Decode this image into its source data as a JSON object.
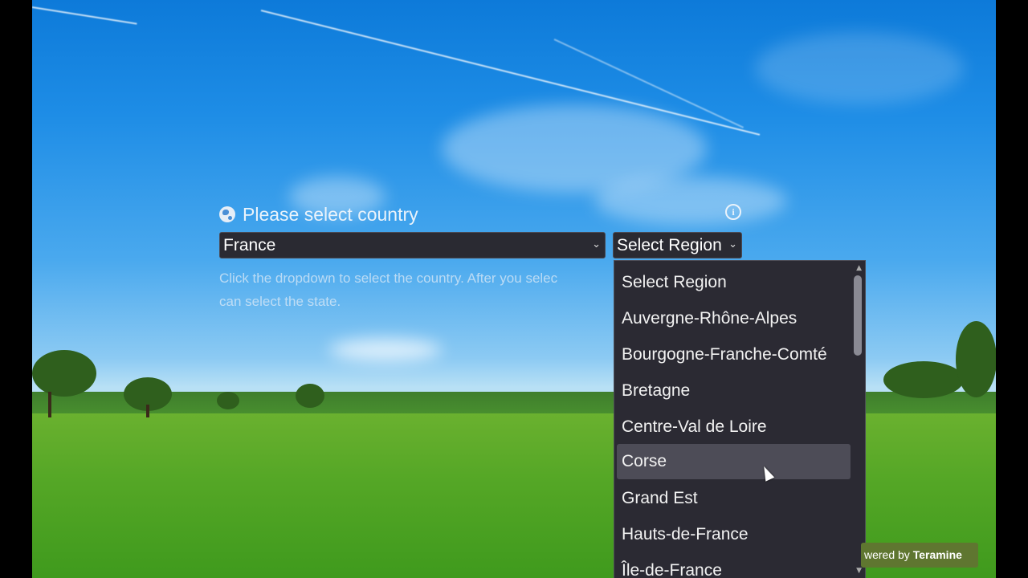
{
  "country_picker": {
    "label": "Please select country",
    "country": "France",
    "region": "Select Region",
    "help_text": "Click the dropdown to select the country. After you selec",
    "help_text_2": "can select the state."
  },
  "region_dropdown": {
    "options": [
      "Select Region",
      "Auvergne-Rhône-Alpes",
      "Bourgogne-Franche-Comté",
      "Bretagne",
      "Centre-Val de Loire",
      "Corse",
      "Grand Est",
      "Hauts-de-France",
      "Île-de-France"
    ],
    "highlighted": "Corse"
  },
  "badge": {
    "prefix": "wered by",
    "brand": "Teramine"
  },
  "icons": {
    "label_icon": "globe-icon",
    "info_icon": "info-icon",
    "select_chevron": "chevron-down-icon"
  },
  "colors": {
    "select_bg": "#2a2a32",
    "highlight_bg": "#4d4c57",
    "badge_bg": "#5f7630"
  }
}
